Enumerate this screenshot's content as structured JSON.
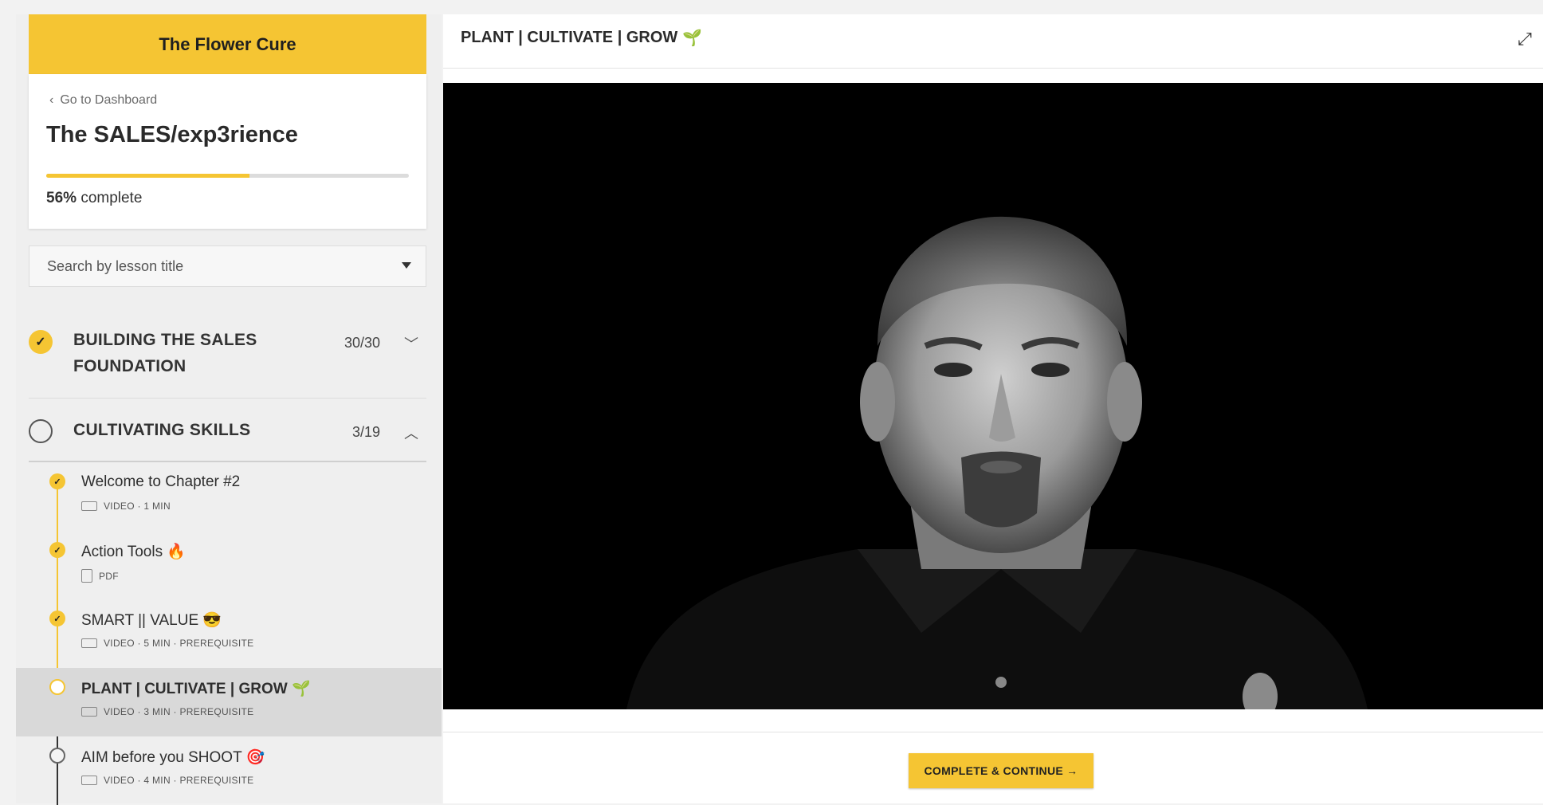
{
  "sidebar": {
    "brand": "The Flower Cure",
    "back_link": "Go to Dashboard",
    "course_title": "The SALES/exp3rience",
    "progress_percent": 56,
    "progress_value": "56%",
    "progress_suffix": "complete",
    "search_placeholder": "Search by lesson title",
    "chapters": [
      {
        "title": "BUILDING THE SALES FOUNDATION",
        "count": "30/30",
        "status": "complete",
        "expanded": false
      },
      {
        "title": "CULTIVATING SKILLS",
        "count": "3/19",
        "status": "in-progress",
        "expanded": true
      }
    ],
    "lessons": [
      {
        "title": "Welcome to Chapter #2",
        "meta": "VIDEO · 1 MIN",
        "type": "video",
        "status": "done"
      },
      {
        "title": "Action Tools 🔥",
        "meta": "PDF",
        "type": "pdf",
        "status": "done"
      },
      {
        "title": "SMART || VALUE 😎",
        "meta": "VIDEO · 5 MIN · PREREQUISITE",
        "type": "video",
        "status": "done"
      },
      {
        "title": "PLANT | CULTIVATE | GROW 🌱",
        "meta": "VIDEO · 3 MIN · PREREQUISITE",
        "type": "video",
        "status": "current"
      },
      {
        "title": "AIM before you SHOOT 🎯",
        "meta": "VIDEO · 4 MIN · PREREQUISITE",
        "type": "video",
        "status": "todo"
      }
    ]
  },
  "main": {
    "lesson_heading": "PLANT | CULTIVATE | GROW",
    "continue_label": "COMPLETE & CONTINUE →"
  },
  "colors": {
    "accent": "#f5c533",
    "video_bg": "#000000"
  },
  "icons": {
    "back": "chevron-left-icon",
    "expand": "expand-icon",
    "sprout": "sprout-icon",
    "check": "check-icon"
  }
}
